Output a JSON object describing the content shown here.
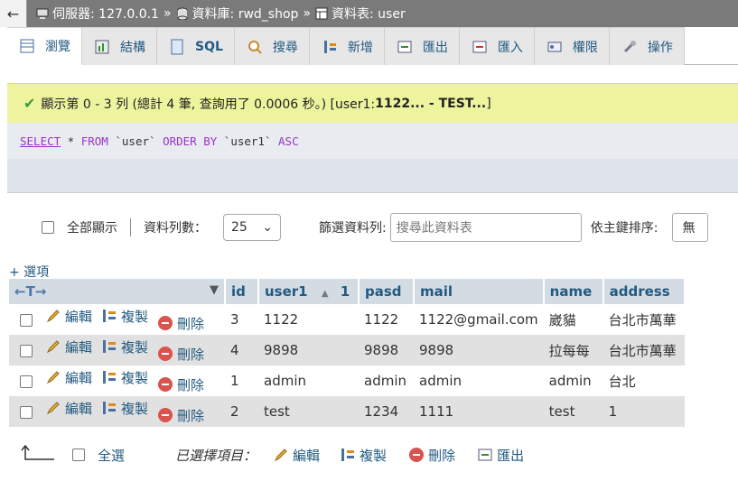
{
  "breadcrumb": {
    "back": "←",
    "server": "伺服器: 127.0.0.1",
    "database": "資料庫: rwd_shop",
    "table": "資料表: user",
    "separator": "»"
  },
  "tabs": [
    {
      "label": "瀏覽",
      "icon": "browse-icon"
    },
    {
      "label": "結構",
      "icon": "structure-icon"
    },
    {
      "label": "SQL",
      "icon": "sql-icon"
    },
    {
      "label": "搜尋",
      "icon": "search-icon"
    },
    {
      "label": "新增",
      "icon": "insert-icon"
    },
    {
      "label": "匯出",
      "icon": "export-icon"
    },
    {
      "label": "匯入",
      "icon": "import-icon"
    },
    {
      "label": "權限",
      "icon": "privileges-icon"
    },
    {
      "label": "操作",
      "icon": "operations-icon"
    }
  ],
  "message": {
    "text": "顯示第 0 - 3 列 (總計 4 筆, 查詢用了 0.0006 秒。) [user1: ",
    "bold": "1122... - TEST...",
    "close": "]"
  },
  "sql": {
    "select": "SELECT",
    "star": " * ",
    "from": "FROM",
    "table": " `user` ",
    "orderby": "ORDER BY",
    "col": " `user1` ",
    "asc": "ASC"
  },
  "controls": {
    "show_all": "全部顯示",
    "rows_label": "資料列數：",
    "rows_value": "25",
    "filter_label": "篩選資料列:",
    "filter_placeholder": "搜尋此資料表",
    "sort_label": "依主鍵排序:",
    "sort_value": "無"
  },
  "options_link": "+ 選項",
  "table": {
    "arrows": "←T→",
    "columns": [
      "id",
      "user1",
      "pasd",
      "mail",
      "name",
      "address"
    ],
    "sort_indicator": "▲",
    "sort_order": "1",
    "actions": {
      "edit": "編輯",
      "copy": "複製",
      "delete": "刪除"
    },
    "rows": [
      {
        "id": "3",
        "user1": "1122",
        "pasd": "1122",
        "mail": "1122@gmail.com",
        "name": "崴貓",
        "address": "台北市萬華"
      },
      {
        "id": "4",
        "user1": "9898",
        "pasd": "9898",
        "mail": "9898",
        "name": "拉每每",
        "address": "台北市萬華"
      },
      {
        "id": "1",
        "user1": "admin",
        "pasd": "admin",
        "mail": "admin",
        "name": "admin",
        "address": "台北"
      },
      {
        "id": "2",
        "user1": "test",
        "pasd": "1234",
        "mail": "1111",
        "name": "test",
        "address": "1"
      }
    ]
  },
  "footer": {
    "select_all": "全選",
    "selected_label": "已選擇項目：",
    "edit": "編輯",
    "copy": "複製",
    "delete": "刪除",
    "export": "匯出"
  },
  "colors": {
    "accent": "#235a81",
    "success_bg": "#eef49e",
    "header_bg": "#d3dce3",
    "row_alt": "#e1e1e1"
  }
}
